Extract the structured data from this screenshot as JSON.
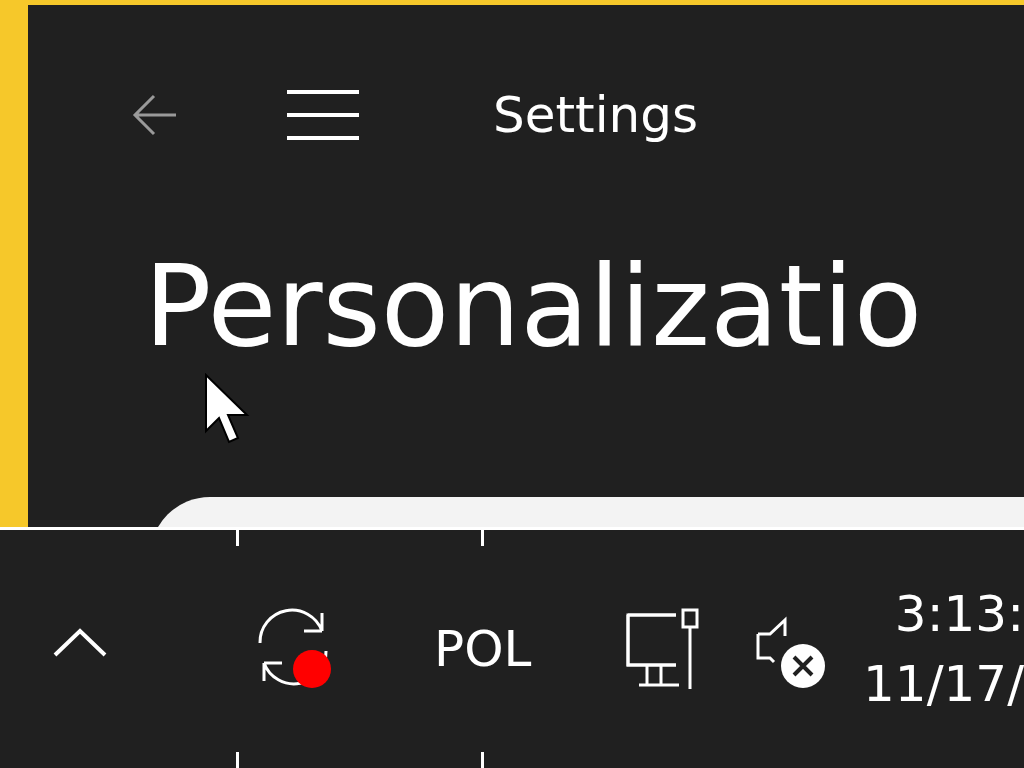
{
  "window": {
    "title": "Settings"
  },
  "page": {
    "heading": "Personalizatio"
  },
  "taskbar": {
    "language": "POL",
    "time": "3:13:",
    "date": "11/17/",
    "sync_alert": true,
    "muted": true
  }
}
